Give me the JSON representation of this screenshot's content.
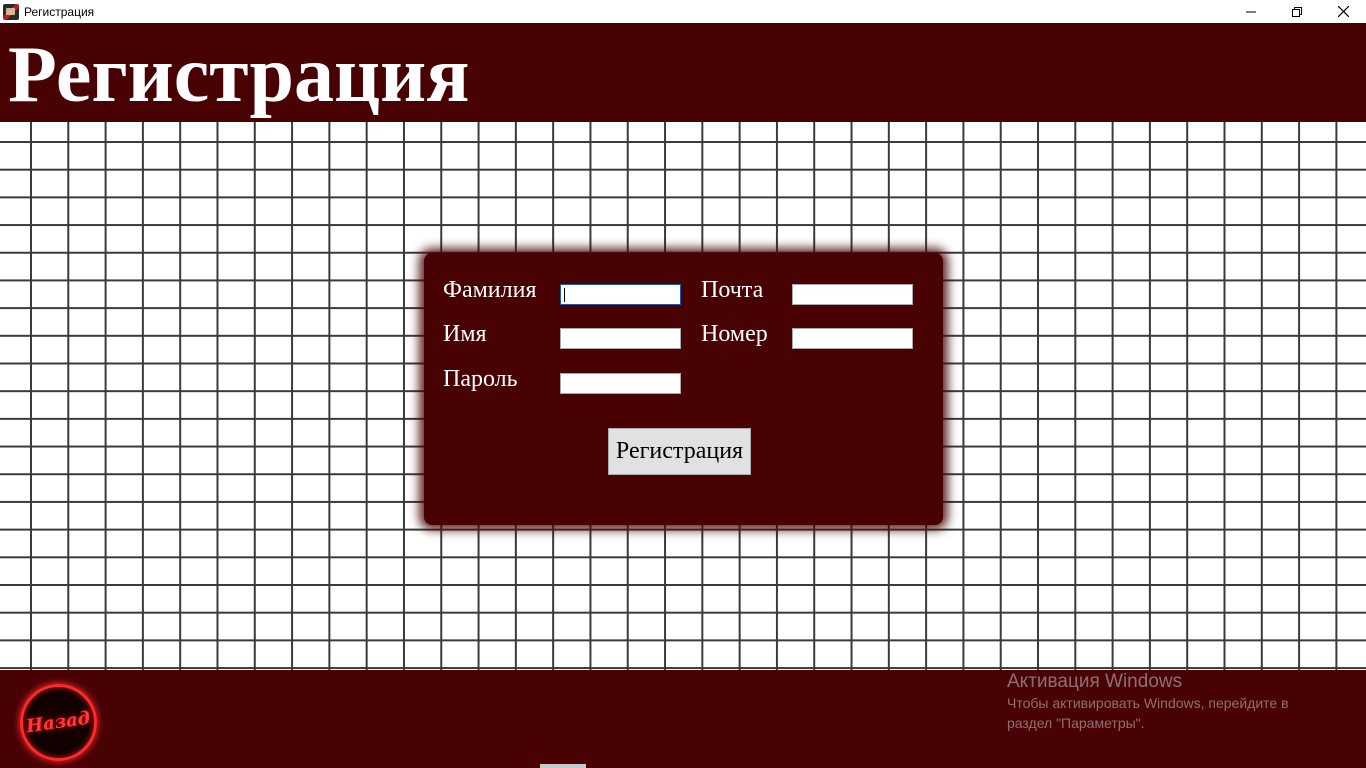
{
  "window": {
    "title": "Регистрация",
    "controls": {
      "minimize": "minimize-icon",
      "restore": "restore-icon",
      "close": "close-icon"
    }
  },
  "header": {
    "title": "Регистрация"
  },
  "form": {
    "labels": {
      "last_name": "Фамилия",
      "first_name": "Имя",
      "password": "Пароль",
      "email": "Почта",
      "phone": "Номер"
    },
    "values": {
      "last_name": "",
      "first_name": "",
      "password": "",
      "email": "",
      "phone": ""
    },
    "submit_label": "Регистрация"
  },
  "footer": {
    "back_label": "Назад"
  },
  "watermark": {
    "title": "Активация Windows",
    "line1": "Чтобы активировать Windows, перейдите в",
    "line2": "раздел \"Параметры\"."
  },
  "colors": {
    "brand_dark_red": "#480204",
    "neon_red": "#ff2a2a",
    "grid_line": "#3a3a3a",
    "button_gray": "#e1e1e1"
  }
}
